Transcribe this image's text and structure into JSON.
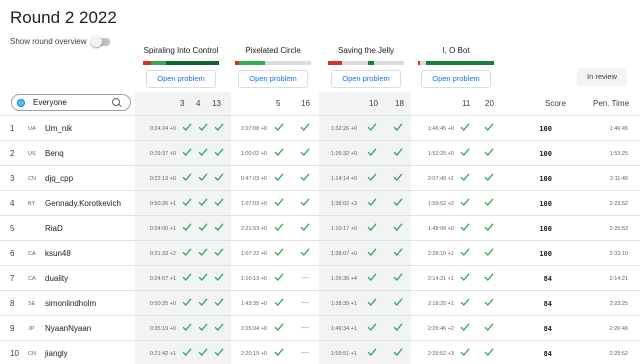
{
  "page": {
    "title": "Round 2 2022",
    "toggle_label": "Show round overview"
  },
  "problems": [
    {
      "name": "Spiraling Into Control",
      "button": "Open problem",
      "segments": [
        [
          "#d93025",
          0.1
        ],
        [
          "#34a853",
          0.2
        ],
        [
          "#0d652d",
          0.7
        ]
      ]
    },
    {
      "name": "Pixelated Circle",
      "button": "Open problem",
      "segments": [
        [
          "#d93025",
          0.05
        ],
        [
          "#34a853",
          0.35
        ],
        [
          "#dadce0",
          0.6
        ]
      ]
    },
    {
      "name": "Saving the Jelly",
      "button": "Open problem",
      "segments": [
        [
          "#d93025",
          0.18
        ],
        [
          "#dadce0",
          0.35
        ],
        [
          "#188038",
          0.07
        ],
        [
          "#dadce0",
          0.4
        ]
      ]
    },
    {
      "name": "I, O Bot",
      "button": "Open problem",
      "segments": [
        [
          "#d93025",
          0.03
        ],
        [
          "#dadce0",
          0.08
        ],
        [
          "#188038",
          0.89
        ]
      ]
    }
  ],
  "review_button": "In review",
  "search": {
    "placeholder": "Everyone"
  },
  "headers": {
    "p1": [
      "3",
      "4",
      "13"
    ],
    "p2": [
      "5",
      "16"
    ],
    "p3": [
      "10",
      "18"
    ],
    "p4": [
      "11",
      "20"
    ],
    "score": "Score",
    "pen_time": "Pen. Time"
  },
  "rows": [
    {
      "rank": "1",
      "cc": "UA",
      "name": "Um_nik",
      "times": [
        "0:24:24 +0",
        "1:07:08 +0",
        "1:32:26 +0",
        "1:46:45 +0"
      ],
      "checks": [
        "yyy",
        "yy",
        "yy",
        "yy"
      ],
      "score": "100",
      "pen": "1:46:45"
    },
    {
      "rank": "2",
      "cc": "US",
      "name": "Benq",
      "times": [
        "0:29:37 +0",
        "1:00:02 +0",
        "1:26:32 +0",
        "1:53:25 +0"
      ],
      "checks": [
        "yyy",
        "yy",
        "yy",
        "yy"
      ],
      "score": "100",
      "pen": "1:53:25"
    },
    {
      "rank": "3",
      "cc": "CN",
      "name": "djq_cpp",
      "times": [
        "0:22:13 +0",
        "0:47:03 +0",
        "1:14:14 +0",
        "2:07:49 +1"
      ],
      "checks": [
        "yyy",
        "yy",
        "yy",
        "yy"
      ],
      "score": "100",
      "pen": "2:11:49"
    },
    {
      "rank": "4",
      "cc": "BY",
      "name": "Gennady.Korotkevich",
      "times": [
        "0:50:26 +1",
        "1:07:03 +0",
        "1:38:02 +3",
        "1:59:52 +2"
      ],
      "checks": [
        "yyy",
        "yy",
        "yy",
        "yy"
      ],
      "score": "100",
      "pen": "2:23:52"
    },
    {
      "rank": "5",
      "cc": "",
      "name": "RiaD",
      "times": [
        "0:24:00 +1",
        "2:21:53 +0",
        "1:10:17 +0",
        "1:48:06 +0"
      ],
      "checks": [
        "yyy",
        "yy",
        "yy",
        "yy"
      ],
      "score": "100",
      "pen": "2:25:53"
    },
    {
      "rank": "6",
      "cc": "CA",
      "name": "ksun48",
      "times": [
        "0:31:33 +2",
        "1:07:22 +0",
        "1:38:07 +0",
        "2:28:10 +1"
      ],
      "checks": [
        "yyy",
        "yy",
        "yy",
        "yy"
      ],
      "score": "100",
      "pen": "2:33:10"
    },
    {
      "rank": "7",
      "cc": "CA",
      "name": "duality",
      "times": [
        "0:24:07 +1",
        "1:10:13 +0",
        "1:26:36 +4",
        "2:14:21 +1"
      ],
      "checks": [
        "yyy",
        "y-",
        "yy",
        "yy"
      ],
      "score": "84",
      "pen": "2:14:21"
    },
    {
      "rank": "8",
      "cc": "SE",
      "name": "simonlindholm",
      "times": [
        "0:50:25 +0",
        "1:43:35 +0",
        "1:38:39 +1",
        "2:18:25 +1"
      ],
      "checks": [
        "yyy",
        "y-",
        "yy",
        "yy"
      ],
      "score": "84",
      "pen": "2:23:25"
    },
    {
      "rank": "9",
      "cc": "JP",
      "name": "NyaanNyaan",
      "times": [
        "0:35:19 +0",
        "1:05:04 +0",
        "1:49:34 +1",
        "2:26:46 +2"
      ],
      "checks": [
        "yyy",
        "y-",
        "yy",
        "yy"
      ],
      "score": "84",
      "pen": "2:26:46"
    },
    {
      "rank": "10",
      "cc": "CN",
      "name": "jiangly",
      "times": [
        "0:21:42 +1",
        "2:20:19 +0",
        "1:59:51 +1",
        "2:29:52 +3"
      ],
      "checks": [
        "yyy",
        "y-",
        "yy",
        "yy"
      ],
      "score": "84",
      "pen": "2:29:52"
    }
  ],
  "colors": {
    "check": "#34a853",
    "stripe": "#f1f3f4"
  }
}
